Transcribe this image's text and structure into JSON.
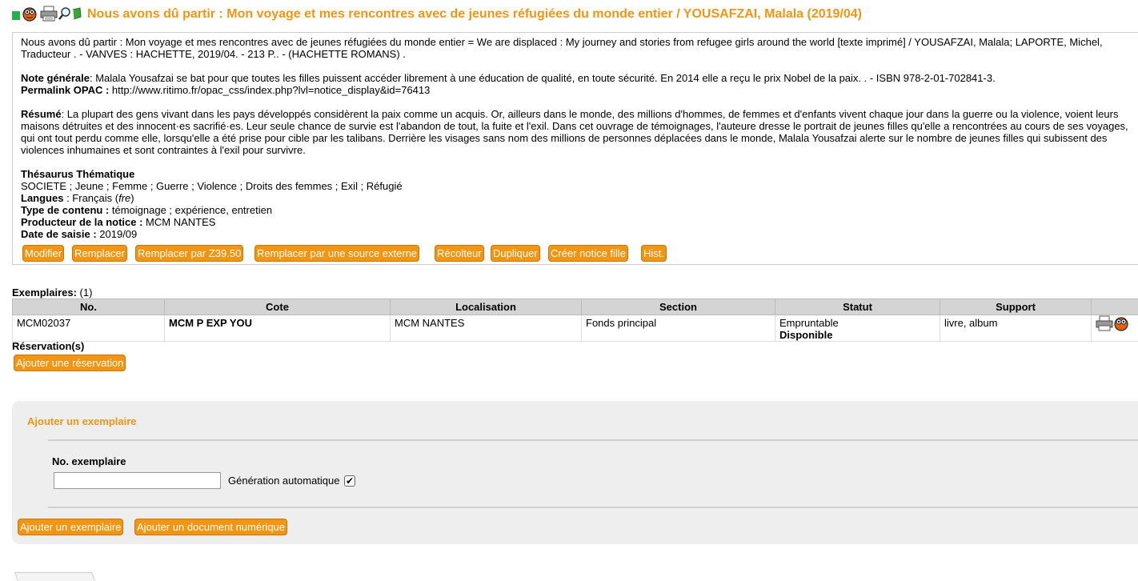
{
  "header": {
    "title": "Nous avons dû partir : Mon voyage et mes rencontres avec de jeunes réfugiées du monde entier / YOUSAFZAI, Malala (2019/04)",
    "icons": [
      "green-square-icon",
      "bug-icon",
      "printer-icon",
      "magnifier-icon",
      "bookmark-icon"
    ]
  },
  "notice": {
    "description": "Nous avons dû partir : Mon voyage et mes rencontres avec de jeunes réfugiées du monde entier = We are displaced : My journey and stories from refugee girls around the world [texte imprimé] / YOUSAFZAI, Malala; LAPORTE, Michel, Traducteur . - VANVES : HACHETTE, 2019/04. - 213 P.. - (HACHETTE ROMANS) .",
    "note_label": "Note générale",
    "note_value": ": Malala Yousafzai se bat pour que toutes les filles puissent accéder librement à une éducation de qualité, en toute sécurité. En 2014 elle a reçu le prix Nobel de la paix. . - ISBN 978-2-01-702841-3.",
    "permalink_label": "Permalink OPAC :",
    "permalink_value": "http://www.ritimo.fr/opac_css/index.php?lvl=notice_display&id=76413",
    "resume_label": "Résumé",
    "resume_value": ": La plupart des gens vivant dans les pays développés considèrent la paix comme un acquis. Or, ailleurs dans le monde, des millions d'hommes, de femmes et d'enfants vivent chaque jour dans la guerre ou la violence, voient leurs maisons détruites et des innocent·es sacrifié·es. Leur seule chance de survie est l'abandon de tout, la fuite et l'exil. Dans cet ouvrage de témoignages, l'auteure dresse le portrait de jeunes filles qu'elle a rencontrées au cours de ses voyages, qui ont tout perdu comme elle, lorsqu'elle a été prise pour cible par les talibans. Derrière les visages sans nom des millions de personnes déplacées dans le monde, Malala Yousafzai alerte sur le nombre de jeunes filles qui subissent des violences inhumaines et sont contraintes à l'exil pour survivre.",
    "thesaurus_label": "Thésaurus Thématique",
    "thesaurus_value": "SOCIETE ; Jeune ; Femme ; Guerre ; Violence ; Droits des femmes ; Exil ; Réfugié",
    "langues_label": "Langues",
    "langues_value": " : Français (",
    "langues_code": "fre",
    "langues_close": ")",
    "type_label": "Type de contenu :",
    "type_value": " témoignage ; expérience, entretien",
    "producteur_label": "Producteur de la notice :",
    "producteur_value": " MCM NANTES",
    "date_label": "Date de saisie :",
    "date_value": " 2019/09"
  },
  "actions": {
    "modifier": "Modifier",
    "remplacer": "Remplacer",
    "remplacer_z3950": "Remplacer par Z39.50",
    "remplacer_externe": "Remplacer par une source externe",
    "recolteur": "Récolteur",
    "dupliquer": "Dupliquer",
    "creer_fille": "Créer notice fille",
    "hist": "Hist."
  },
  "exemplaires": {
    "label": "Exemplaires:",
    "count": " (1)",
    "columns": [
      "No.",
      "Cote",
      "Localisation",
      "Section",
      "Statut",
      "Support",
      ""
    ],
    "rows": [
      {
        "no": "MCM02037",
        "cote": "MCM P EXP YOU",
        "localisation": "MCM NANTES",
        "section": "Fonds principal",
        "statut_line1": "Empruntable",
        "statut_line2": "Disponible",
        "support": "livre, album"
      }
    ]
  },
  "reservations": {
    "label": "Réservation(s)",
    "add_button": "Ajouter une réservation"
  },
  "add_exemplaire": {
    "title": "Ajouter un exemplaire",
    "field_label": "No. exemplaire",
    "field_value": "",
    "auto_label": "Génération automatique",
    "auto_checked": true,
    "add_button": "Ajouter un exemplaire",
    "add_numeric_button": "Ajouter un document numérique"
  },
  "colors": {
    "accent": "#f29513",
    "header_bg": "#d4d4d4",
    "panel_bg": "#eeeeee"
  }
}
